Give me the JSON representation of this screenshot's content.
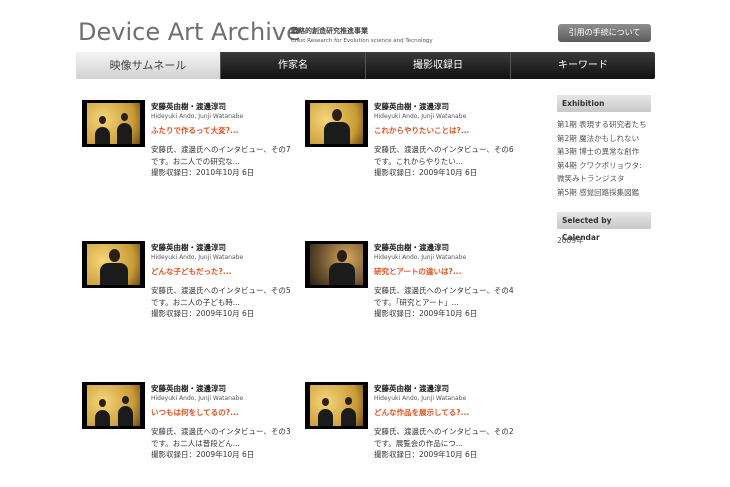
{
  "header": {
    "title": "Device Art Archive",
    "subtitle_jp": "戦略的創造研究推進事業",
    "subtitle_en": "Crest Research for Evolution science and Tecnology",
    "cite_button": "引用の手続について"
  },
  "nav": {
    "tabs": [
      "映像サムネール",
      "作家名",
      "撮影収録日",
      "キーワード"
    ]
  },
  "cards": [
    {
      "name": "安藤英由樹・渡邊淳司",
      "roman": "Hideyuki Ando, Junji Watanabe",
      "title": "ふたりで作るって大変?...",
      "desc": "安藤氏、渡邊氏へのインタビュー、その7です。お二人での研究な...",
      "date": "撮影収録日：2010年10月 6日"
    },
    {
      "name": "安藤英由樹・渡邊淳司",
      "roman": "Hideyuki Ando, Junji Watanabe",
      "title": "これからやりたいことは?...",
      "desc": "安藤氏、渡邊氏へのインタビュー、その6です。これからやりたい...",
      "date": "撮影収録日：2009年10月 6日"
    },
    {
      "name": "安藤英由樹・渡邊淳司",
      "roman": "Hideyuki Ando, Junji Watanabe",
      "title": "どんな子どもだった?...",
      "desc": "安藤氏、渡邊氏へのインタビュー、その5です。お二人の子ども時...",
      "date": "撮影収録日：2009年10月 6日"
    },
    {
      "name": "安藤英由樹・渡邊淳司",
      "roman": "Hideyuki Ando, Junji Watanabe",
      "title": "研究とアートの違いは?...",
      "desc": "安藤氏、渡邊氏へのインタビュー、その4です。「研究とアート」...",
      "date": "撮影収録日：2009年10月 6日"
    },
    {
      "name": "安藤英由樹・渡邊淳司",
      "roman": "Hideyuki Ando, Junji Watanabe",
      "title": "いつもは何をしてるの?...",
      "desc": "安藤氏、渡邊氏へのインタビュー、その3です。お二人は普段どん...",
      "date": "撮影収録日：2009年10月 6日"
    },
    {
      "name": "安藤英由樹・渡邊淳司",
      "roman": "Hideyuki Ando, Junji Watanabe",
      "title": "どんな作品を展示してる?...",
      "desc": "安藤氏、渡邊氏へのインタビュー、その2です。展覧会の作品につ...",
      "date": "撮影収録日：2009年10月 6日"
    }
  ],
  "sidebar": {
    "exhibition_heading": "Exhibition",
    "exhibition_items": [
      "第1期 表現する研究者たち",
      "第2期 魔法かもしれない",
      "第3期 博士の異常な創作",
      "第4期 クワクポリョウタ:",
      "微笑みトランジスタ",
      "第5期 感覚回路採集図鑑"
    ],
    "calendar_heading": "Selected by Calendar",
    "year": "2009年"
  },
  "colors": {
    "accent_title": "#e05020",
    "nav_dark": "#1a1a1a",
    "nav_active": "#e0e0e0"
  }
}
